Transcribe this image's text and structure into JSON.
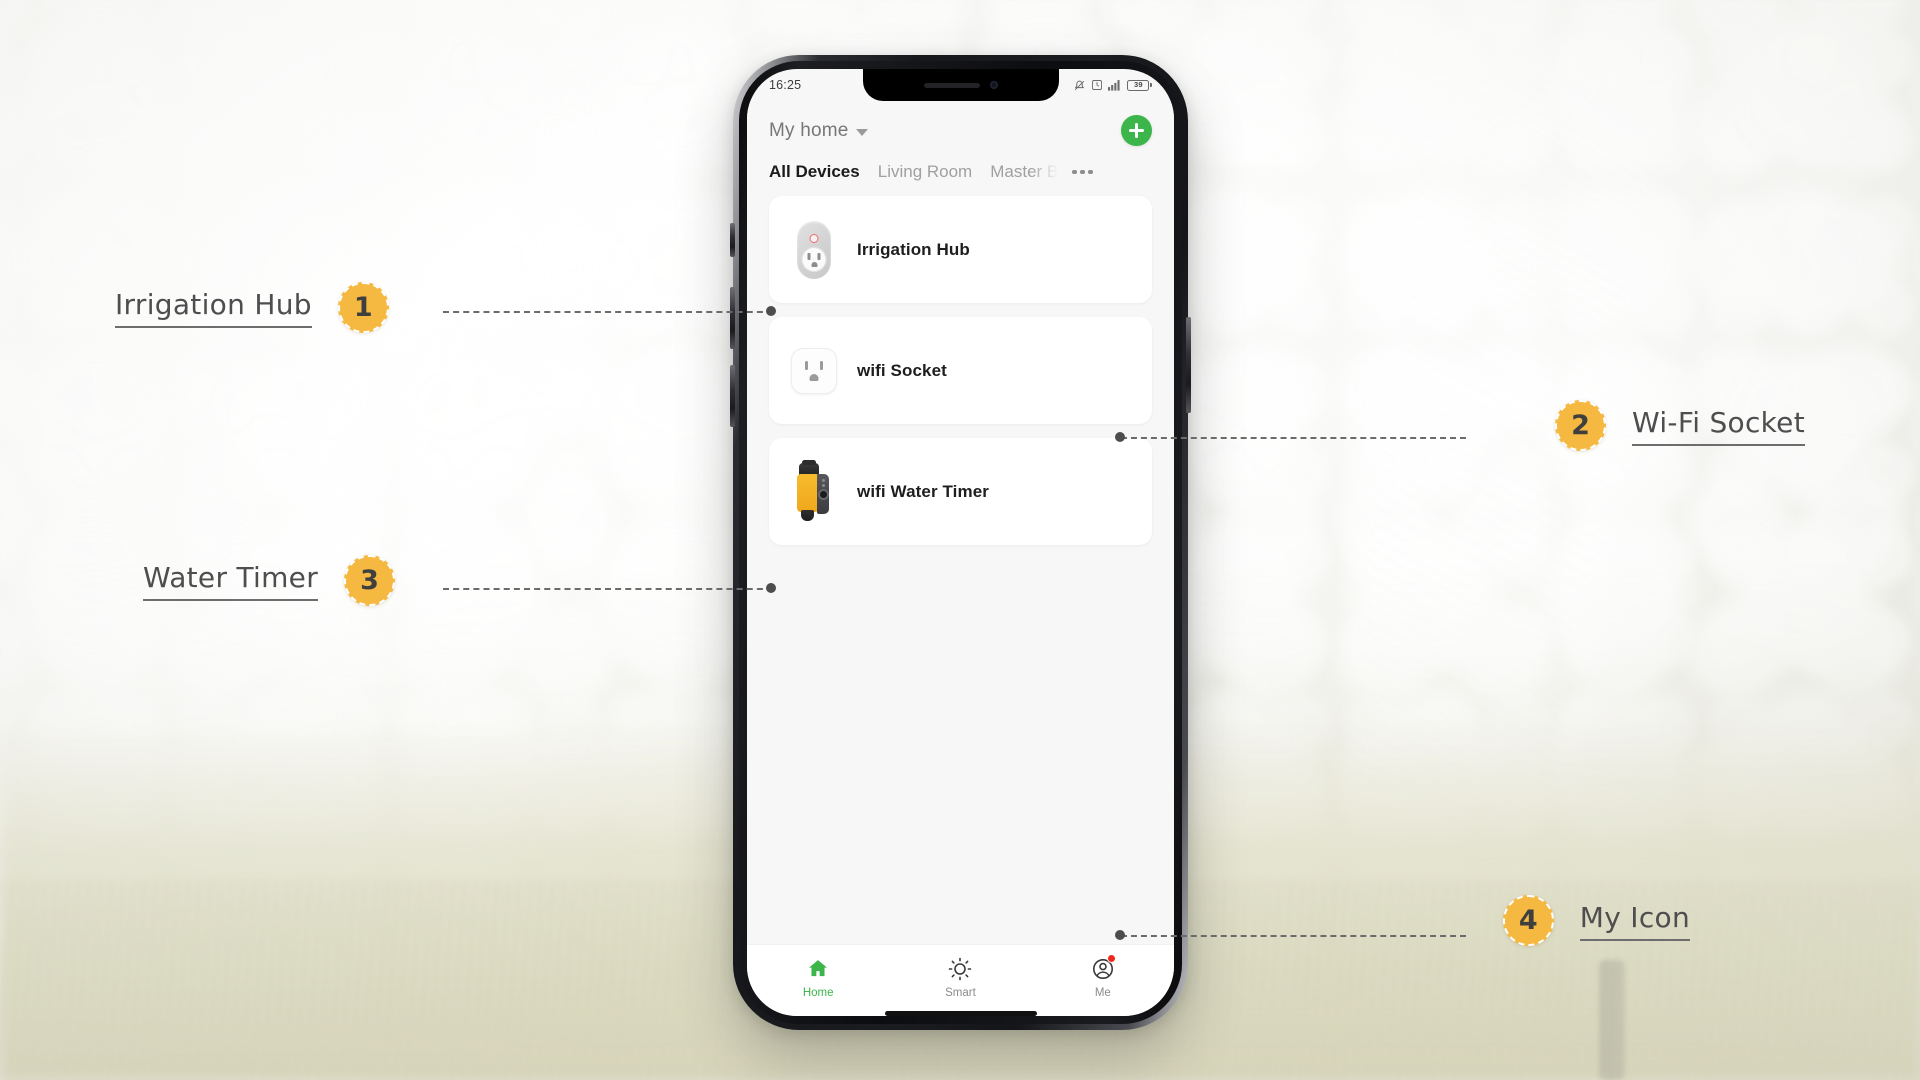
{
  "phone": {
    "status_bar": {
      "time": "16:25",
      "icons": [
        "silent-icon",
        "alarm-icon",
        "signal-icon",
        "battery-icon"
      ],
      "battery_percent": "39"
    },
    "app_header": {
      "home_label": "My home",
      "home_caret_icon": "chevron-down-icon",
      "add_button_icon": "plus-icon",
      "add_button_color": "#3cb54a"
    },
    "tabs": [
      {
        "label": "All Devices",
        "active": true
      },
      {
        "label": "Living Room",
        "active": false
      },
      {
        "label": "Master B",
        "active": false
      }
    ],
    "tabs_overflow_icon": "ellipsis-icon",
    "devices": [
      {
        "name": "Irrigation Hub",
        "icon": "smart-plug-hub-icon"
      },
      {
        "name": "wifi Socket",
        "icon": "wifi-socket-icon"
      },
      {
        "name": "wifi Water Timer",
        "icon": "water-timer-icon"
      }
    ],
    "bottom_nav": [
      {
        "label": "Home",
        "icon": "house-icon",
        "active": true,
        "badge": false
      },
      {
        "label": "Smart",
        "icon": "sun-icon",
        "active": false,
        "badge": false
      },
      {
        "label": "Me",
        "icon": "person-circle-icon",
        "active": false,
        "badge": true
      }
    ],
    "active_nav_color": "#3cb54a",
    "badge_color": "#ee2a1e"
  },
  "callouts": [
    {
      "number": "1",
      "label": "Irrigation Hub"
    },
    {
      "number": "2",
      "label": "Wi-Fi Socket"
    },
    {
      "number": "3",
      "label": "Water Timer"
    },
    {
      "number": "4",
      "label": "My Icon"
    }
  ],
  "callout_badge_color": "#f5b942"
}
